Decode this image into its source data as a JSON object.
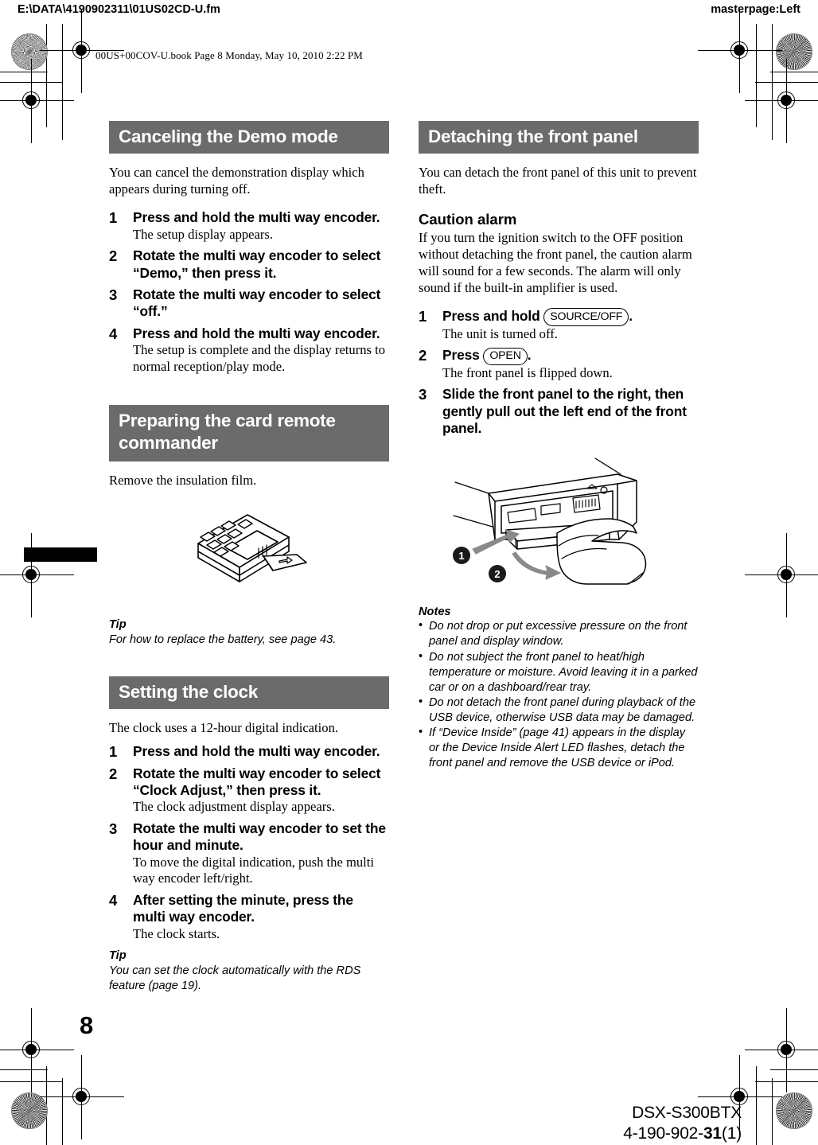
{
  "prepress": {
    "file_path": "E:\\DATA\\4190902311\\01US02CD-U.fm",
    "masterpage": "masterpage:Left",
    "bookline": "00US+00COV-U.book  Page 8  Monday, May 10, 2010  2:22 PM"
  },
  "page": {
    "number": "8",
    "footer_model": "DSX-S300BTX",
    "footer_part_prefix": "4-190-902-",
    "footer_part_bold": "31",
    "footer_part_suffix": "(1)"
  },
  "colors": {
    "section_bar": "#6b6b6b",
    "text": "#000000",
    "paper": "#ffffff"
  },
  "left_column": {
    "sections": [
      {
        "heading": "Canceling the Demo mode",
        "intro": "You can cancel the demonstration display which appears during turning off.",
        "steps": [
          {
            "num": "1",
            "title": "Press and hold the multi way encoder.",
            "desc": "The setup display appears."
          },
          {
            "num": "2",
            "title": "Rotate the multi way encoder to select “Demo,” then press it.",
            "desc": ""
          },
          {
            "num": "3",
            "title": "Rotate the multi way encoder to select “off.”",
            "desc": ""
          },
          {
            "num": "4",
            "title": "Press and hold the multi way encoder.",
            "desc": "The setup is complete and the display returns to normal reception/play mode."
          }
        ]
      },
      {
        "heading": "Preparing the card remote commander",
        "intro": "Remove the insulation film.",
        "figure_name": "card-remote-commander-illustration",
        "tip_label": "Tip",
        "tip_text": "For how to replace the battery, see page 43."
      },
      {
        "heading": "Setting the clock",
        "intro": "The clock uses a 12-hour digital indication.",
        "steps": [
          {
            "num": "1",
            "title": "Press and hold the multi way encoder.",
            "desc": ""
          },
          {
            "num": "2",
            "title": "Rotate the multi way encoder to select “Clock Adjust,” then press it.",
            "desc": "The clock adjustment display appears."
          },
          {
            "num": "3",
            "title": "Rotate the multi way encoder to set the hour and minute.",
            "desc": "To move the digital indication, push the multi way encoder left/right."
          },
          {
            "num": "4",
            "title": "After setting the minute, press the multi way encoder.",
            "desc": "The clock starts."
          }
        ],
        "tip_label": "Tip",
        "tip_text": "You can set the clock automatically with the RDS feature (page 19)."
      }
    ]
  },
  "right_column": {
    "heading": "Detaching the front panel",
    "intro": "You can detach the front panel of this unit to prevent theft.",
    "subhead": "Caution alarm",
    "subhead_text": "If you turn the ignition switch to the OFF position without detaching the front panel, the caution alarm will sound for a few seconds. The alarm will only sound if the built-in amplifier is used.",
    "steps": [
      {
        "num": "1",
        "title_before": "Press and hold ",
        "keycap": "SOURCE/OFF",
        "title_after": ".",
        "desc": "The unit is turned off."
      },
      {
        "num": "2",
        "title_before": "Press ",
        "keycap": "OPEN",
        "title_after": ".",
        "desc": "The front panel is flipped down."
      },
      {
        "num": "3",
        "title_before": "Slide the front panel to the right, then gently pull out the left end of the front panel.",
        "keycap": "",
        "title_after": "",
        "desc": ""
      }
    ],
    "figure_name": "detaching-front-panel-illustration",
    "figure_callouts": [
      "1",
      "2"
    ],
    "notes_label": "Notes",
    "notes": [
      "Do not drop or put excessive pressure on the front panel and display window.",
      "Do not subject the front panel to heat/high temperature or moisture. Avoid leaving it in a parked car or on a dashboard/rear tray.",
      "Do not detach the front panel during playback of the USB device, otherwise USB data may be damaged.",
      "If “Device Inside” (page 41) appears in the display or the Device Inside Alert LED flashes, detach the front panel and remove the USB device or iPod."
    ]
  }
}
